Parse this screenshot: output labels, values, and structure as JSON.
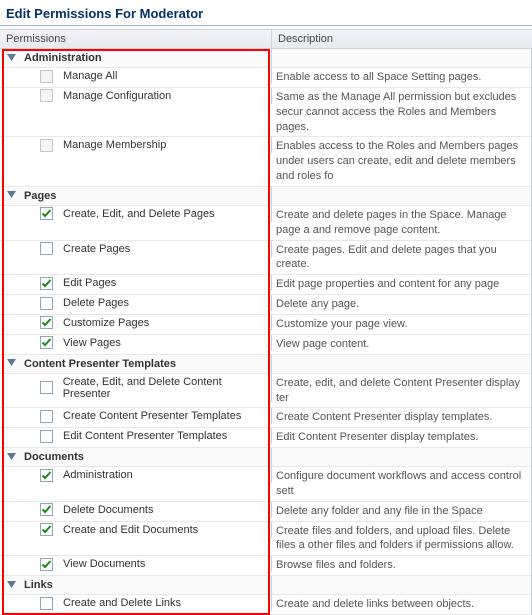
{
  "title": "Edit Permissions For Moderator",
  "headers": {
    "permissions": "Permissions",
    "description": "Description"
  },
  "groups": [
    {
      "name": "Administration",
      "items": [
        {
          "label": "Manage All",
          "checked": false,
          "disabled": true,
          "desc": "Enable access to all Space Setting pages."
        },
        {
          "label": "Manage Configuration",
          "checked": false,
          "disabled": true,
          "desc": "Same as the Manage All permission but excludes secur cannot access the Roles and Members pages."
        },
        {
          "label": "Manage Membership",
          "checked": false,
          "disabled": true,
          "desc": "Enables access to the Roles and Members pages under users can create, edit and delete members and roles fo"
        }
      ]
    },
    {
      "name": "Pages",
      "items": [
        {
          "label": "Create, Edit, and Delete Pages",
          "checked": true,
          "disabled": false,
          "desc": "Create and delete pages in the Space. Manage page a and remove page content."
        },
        {
          "label": "Create Pages",
          "checked": false,
          "disabled": false,
          "desc": "Create pages. Edit and delete pages that you create."
        },
        {
          "label": "Edit Pages",
          "checked": true,
          "disabled": false,
          "desc": "Edit page properties and content for any page"
        },
        {
          "label": "Delete Pages",
          "checked": false,
          "disabled": false,
          "desc": "Delete any page."
        },
        {
          "label": "Customize Pages",
          "checked": true,
          "disabled": false,
          "desc": "Customize your page view."
        },
        {
          "label": "View Pages",
          "checked": true,
          "disabled": false,
          "desc": "View page content."
        }
      ]
    },
    {
      "name": "Content Presenter Templates",
      "items": [
        {
          "label": "Create, Edit, and Delete Content Presenter",
          "checked": false,
          "disabled": false,
          "desc": "Create, edit, and delete Content Presenter display ter"
        },
        {
          "label": "Create Content Presenter Templates",
          "checked": false,
          "disabled": false,
          "desc": "Create Content Presenter display templates."
        },
        {
          "label": "Edit Content Presenter Templates",
          "checked": false,
          "disabled": false,
          "desc": "Edit Content Presenter display templates."
        }
      ]
    },
    {
      "name": "Documents",
      "items": [
        {
          "label": "Administration",
          "checked": true,
          "disabled": false,
          "desc": "Configure document workflows and access control sett"
        },
        {
          "label": "Delete Documents",
          "checked": true,
          "disabled": false,
          "desc": "Delete any folder and any file in the Space"
        },
        {
          "label": "Create and Edit Documents",
          "checked": true,
          "disabled": false,
          "desc": "Create files and folders, and upload files. Delete files a other files and folders if permissions allow."
        },
        {
          "label": "View Documents",
          "checked": true,
          "disabled": false,
          "desc": "Browse files and folders."
        }
      ]
    },
    {
      "name": "Links",
      "items": [
        {
          "label": "Create and Delete Links",
          "checked": false,
          "disabled": false,
          "desc": "Create and delete links between objects."
        }
      ]
    }
  ]
}
